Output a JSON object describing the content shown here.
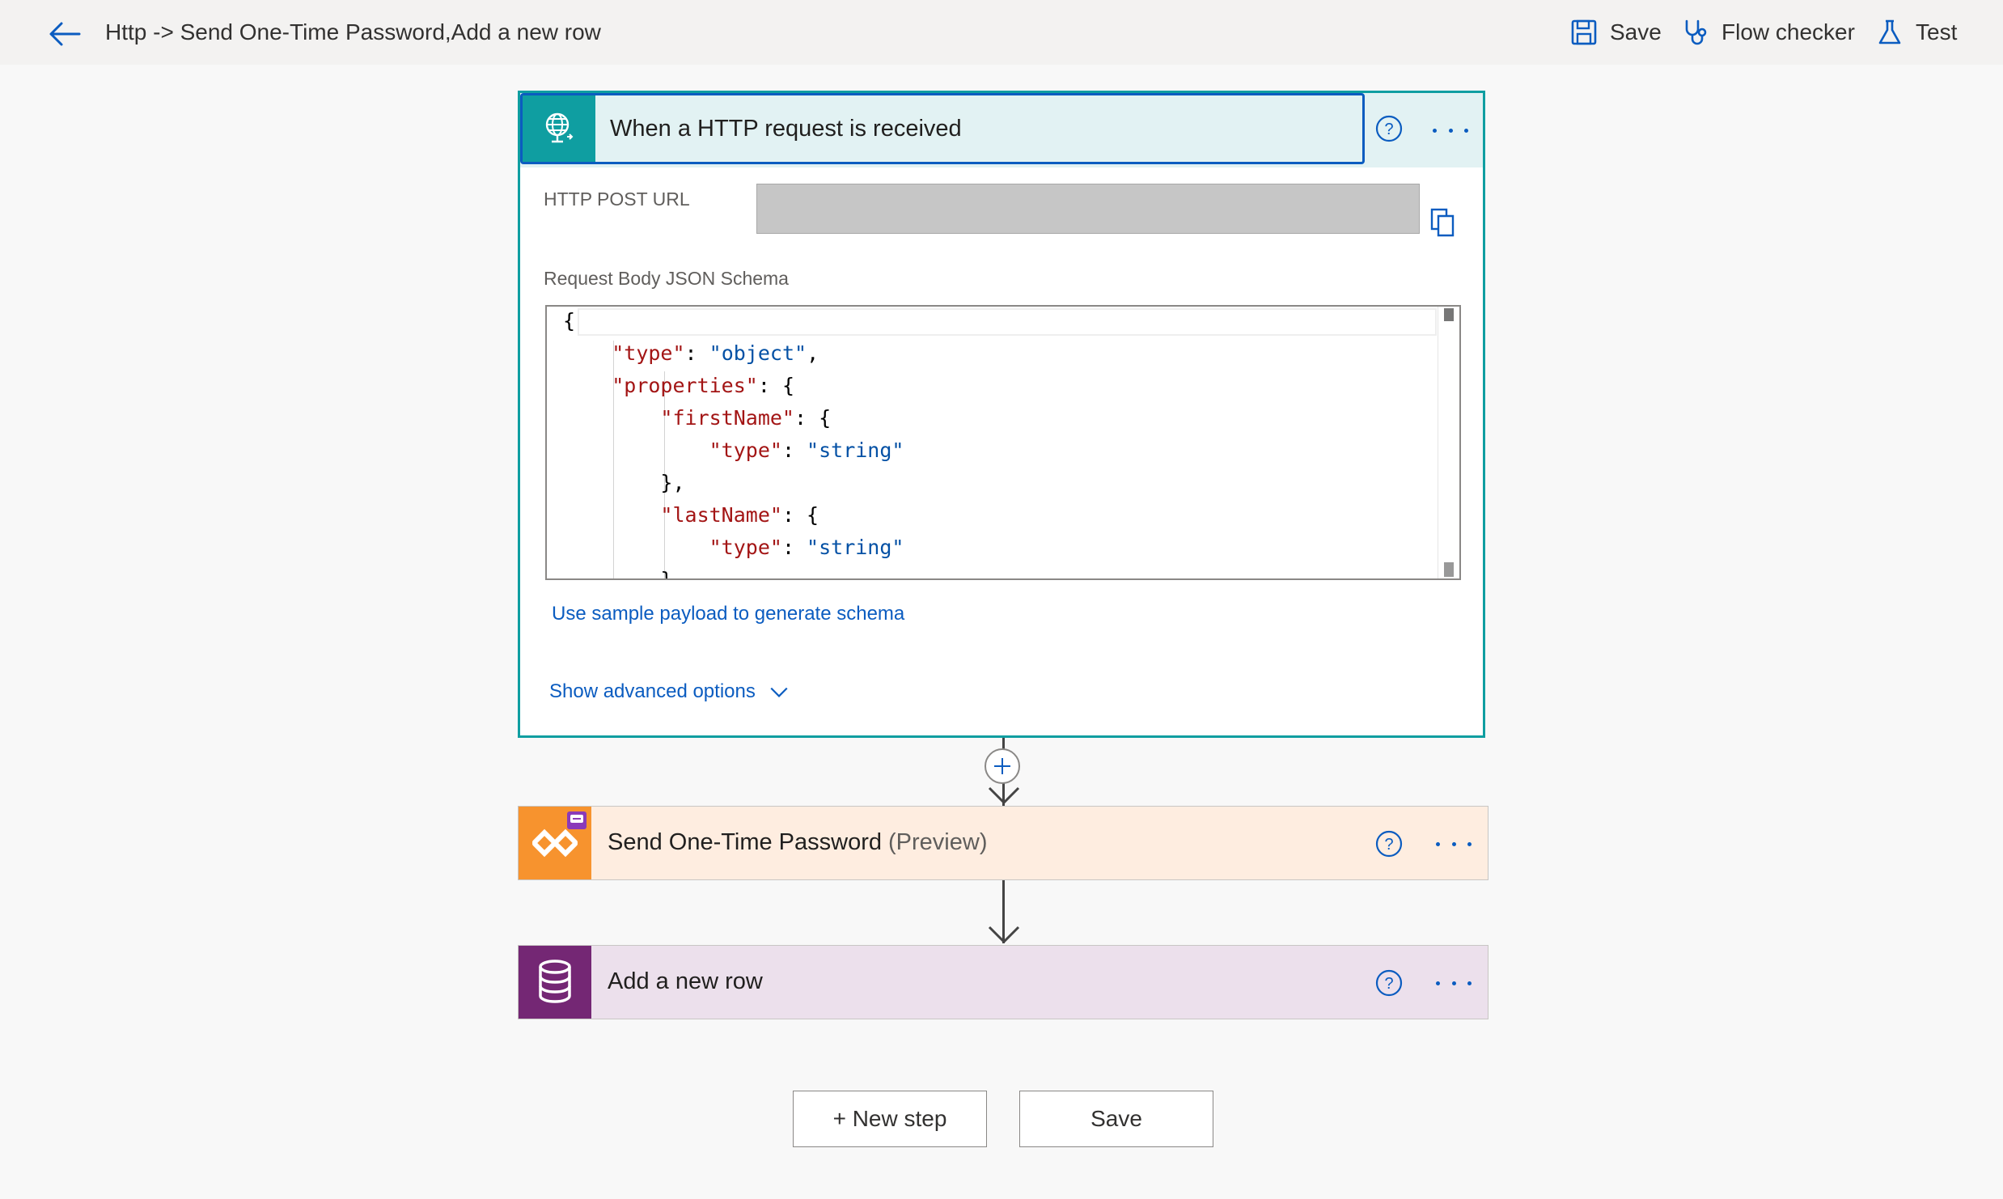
{
  "header": {
    "flow_title": "Http -> Send One-Time Password,Add a new row",
    "commands": {
      "save": "Save",
      "flow_checker": "Flow checker",
      "test": "Test"
    }
  },
  "trigger": {
    "title": "When a HTTP request is received",
    "icon": "http-globe-icon",
    "url_label": "HTTP POST URL",
    "url_value": "",
    "schema_label": "Request Body JSON Schema",
    "schema_lines": [
      "{",
      "    \"type\": \"object\",",
      "    \"properties\": {",
      "        \"firstName\": {",
      "            \"type\": \"string\"",
      "        },",
      "        \"lastName\": {",
      "            \"type\": \"string\"",
      "        }"
    ],
    "sample_payload_link": "Use sample payload to generate schema",
    "advanced_options": "Show advanced options"
  },
  "steps": [
    {
      "title": "Send One-Time Password",
      "tag": "(Preview)",
      "icon": "connector-icon"
    },
    {
      "title": "Add a new row",
      "tag": "",
      "icon": "database-icon"
    }
  ],
  "footer": {
    "new_step": "+ New step",
    "save": "Save"
  },
  "colors": {
    "accent": "#0b5cc0",
    "trigger": "#0f9ea1",
    "otp": "#f7932e",
    "dataverse": "#742774"
  }
}
